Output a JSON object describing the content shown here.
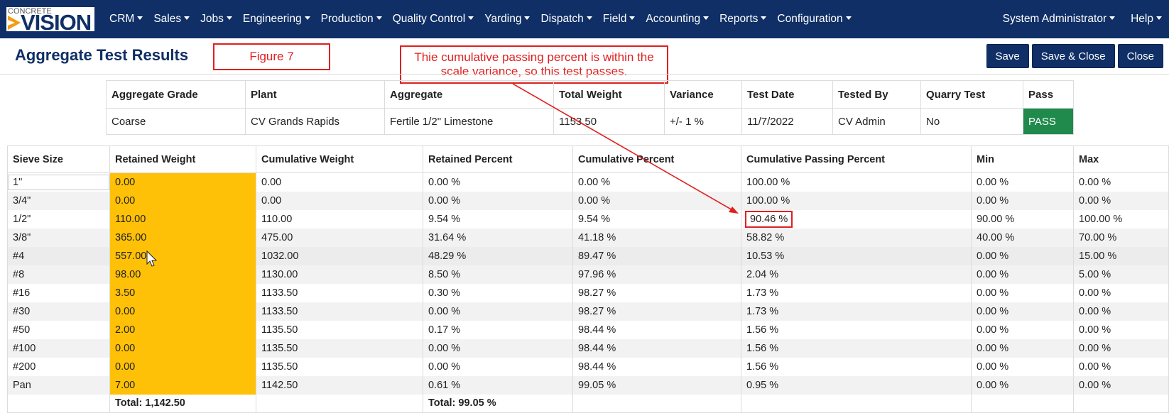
{
  "logo": {
    "small": "CONCRETE",
    "big": "VISION"
  },
  "nav": {
    "menu": [
      "CRM",
      "Sales",
      "Jobs",
      "Engineering",
      "Production",
      "Quality Control",
      "Yarding",
      "Dispatch",
      "Field",
      "Accounting",
      "Reports",
      "Configuration"
    ],
    "user": "System Administrator",
    "help": "Help"
  },
  "page": {
    "title": "Aggregate Test Results",
    "figure_label": "Figure 7",
    "callout": "Thie cumulative passing percent is within the scale variance, so this test passes.",
    "buttons": {
      "save": "Save",
      "save_close": "Save & Close",
      "close": "Close"
    }
  },
  "summary": {
    "headers": [
      "Aggregate Grade",
      "Plant",
      "Aggregate",
      "Total Weight",
      "Variance",
      "Test Date",
      "Tested By",
      "Quarry Test",
      "Pass"
    ],
    "row": [
      "Coarse",
      "CV Grands Rapids",
      "Fertile 1/2\" Limestone",
      "1153.50",
      "+/- 1 %",
      "11/7/2022",
      "CV Admin",
      "No",
      "PASS"
    ]
  },
  "sieve": {
    "headers": [
      "Sieve Size",
      "Retained Weight",
      "Cumulative Weight",
      "Retained Percent",
      "Cumulative Percent",
      "Cumulative Passing Percent",
      "Min",
      "Max"
    ],
    "rows": [
      [
        "1\"",
        "0.00",
        "0.00",
        "0.00 %",
        "0.00 %",
        "100.00 %",
        "0.00 %",
        "0.00 %"
      ],
      [
        "3/4\"",
        "0.00",
        "0.00",
        "0.00 %",
        "0.00 %",
        "100.00 %",
        "0.00 %",
        "0.00 %"
      ],
      [
        "1/2\"",
        "110.00",
        "110.00",
        "9.54 %",
        "9.54 %",
        "90.46 %",
        "90.00 %",
        "100.00 %"
      ],
      [
        "3/8\"",
        "365.00",
        "475.00",
        "31.64 %",
        "41.18 %",
        "58.82 %",
        "40.00 %",
        "70.00 %"
      ],
      [
        "#4",
        "557.00",
        "1032.00",
        "48.29 %",
        "89.47 %",
        "10.53 %",
        "0.00 %",
        "15.00 %"
      ],
      [
        "#8",
        "98.00",
        "1130.00",
        "8.50 %",
        "97.96 %",
        "2.04 %",
        "0.00 %",
        "5.00 %"
      ],
      [
        "#16",
        "3.50",
        "1133.50",
        "0.30 %",
        "98.27 %",
        "1.73 %",
        "0.00 %",
        "0.00 %"
      ],
      [
        "#30",
        "0.00",
        "1133.50",
        "0.00 %",
        "98.27 %",
        "1.73 %",
        "0.00 %",
        "0.00 %"
      ],
      [
        "#50",
        "2.00",
        "1135.50",
        "0.17 %",
        "98.44 %",
        "1.56 %",
        "0.00 %",
        "0.00 %"
      ],
      [
        "#100",
        "0.00",
        "1135.50",
        "0.00 %",
        "98.44 %",
        "1.56 %",
        "0.00 %",
        "0.00 %"
      ],
      [
        "#200",
        "0.00",
        "1135.50",
        "0.00 %",
        "98.44 %",
        "1.56 %",
        "0.00 %",
        "0.00 %"
      ],
      [
        "Pan",
        "7.00",
        "1142.50",
        "0.61 %",
        "99.05 %",
        "0.95 %",
        "0.00 %",
        "0.00 %"
      ]
    ],
    "total_weight": "Total: 1,142.50",
    "total_percent": "Total: 99.05 %"
  },
  "colors": {
    "navbar": "#0f2f66",
    "retained": "#ffc107",
    "pass": "#1f8a4c",
    "annotation": "#e02020"
  }
}
